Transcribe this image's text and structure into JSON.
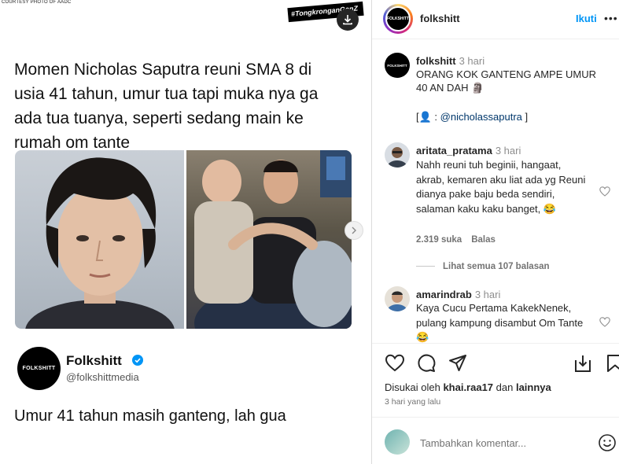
{
  "left": {
    "courtesy": "COURTESY PHOTO OF AADC",
    "hashtag": "#TongkronganGenZ",
    "headline": "Momen Nicholas Saputra reuni SMA 8 di usia 41 tahun, umur tua tapi muka nya ga ada tua tuanya, seperti sedang main ke rumah om tante",
    "brand_logo_text": "FOLKSHITT",
    "brand_name": "Folkshitt",
    "brand_handle": "@folkshittmedia",
    "caption": "Umur 41 tahun masih ganteng, lah gua"
  },
  "header": {
    "avatar_text": "FOLKSHITT",
    "username": "folkshitt",
    "follow_label": "Ikuti",
    "more_label": "•••"
  },
  "post": {
    "avatar_text": "FOLKSHITT",
    "username": "folkshitt",
    "time": "3 hari",
    "caption": "ORANG KOK GANTENG AMPE UMUR 40 AN DAH 🗿",
    "mention_prefix": "[👤 : ",
    "mention": "@nicholassaputra",
    "mention_suffix": " ]"
  },
  "comments": [
    {
      "username": "aritata_pratama",
      "time": "3 hari",
      "text": "Nahh reuni tuh beginii, hangaat, akrab, kemaren aku liat ada yg Reuni dianya pake baju beda sendiri, salaman kaku kaku banget, 😂",
      "likes": "2.319 suka",
      "reply": "Balas",
      "replies": "Lihat semua 107 balasan"
    },
    {
      "username": "amarindrab",
      "time": "3 hari",
      "text": "Kaya Cucu Pertama KakekNenek, pulang kampung disambut Om Tante 😂"
    }
  ],
  "actions": {
    "liked_prefix": "Disukai oleh ",
    "liked_user": "khai.raa17",
    "liked_mid": " dan ",
    "liked_others": "lainnya",
    "date": "3 hari yang lalu"
  },
  "comment_box": {
    "placeholder": "Tambahkan komentar..."
  },
  "icons": [
    "download-icon",
    "chevron-right-icon",
    "verified-icon",
    "heart-icon",
    "comment-icon",
    "share-icon",
    "save-icon",
    "emoji-icon"
  ],
  "colors": {
    "link": "#0095f6",
    "mention": "#00376b",
    "verified": "#0095f6"
  }
}
